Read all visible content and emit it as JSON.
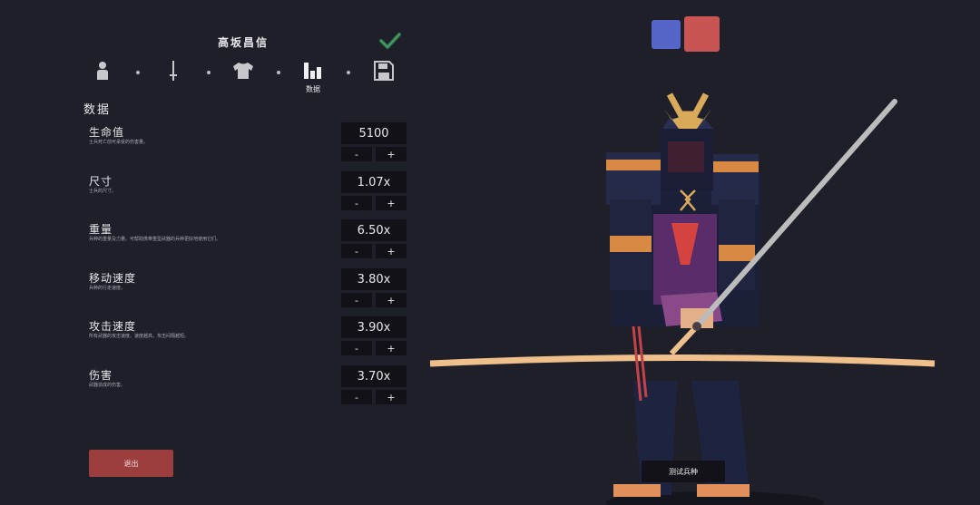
{
  "unit": {
    "name": "高坂昌信"
  },
  "tabs": [
    {
      "icon": "person-icon"
    },
    {
      "icon": "sword-icon"
    },
    {
      "icon": "shirt-icon"
    },
    {
      "icon": "stats-icon",
      "label": "数据",
      "active": true
    },
    {
      "icon": "save-icon"
    }
  ],
  "section": {
    "title": "数据"
  },
  "stats": [
    {
      "name": "生命值",
      "desc": "士兵死亡前可承受的伤害量。",
      "value": "5100"
    },
    {
      "name": "尺寸",
      "desc": "士兵的尺寸。",
      "value": "1.07x"
    },
    {
      "name": "重量",
      "desc": "兵种的重量及力量。可帮助携带重型武器的兵种更好地使用它们。",
      "value": "6.50x"
    },
    {
      "name": "移动速度",
      "desc": "兵种的行走速度。",
      "value": "3.80x"
    },
    {
      "name": "攻击速度",
      "desc": "所有武器的攻击速度。速度越高，攻击间隔越短。",
      "value": "3.90x"
    },
    {
      "name": "伤害",
      "desc": "武器造成的伤害。",
      "value": "3.70x"
    }
  ],
  "buttons": {
    "minus": "-",
    "plus": "+",
    "exit": "退出",
    "test": "测试兵种"
  },
  "colors": {
    "blue_team": "#5566c8",
    "red_team": "#c85454",
    "accent_exit": "#9c3e3e",
    "check": "#2f7a4a"
  }
}
